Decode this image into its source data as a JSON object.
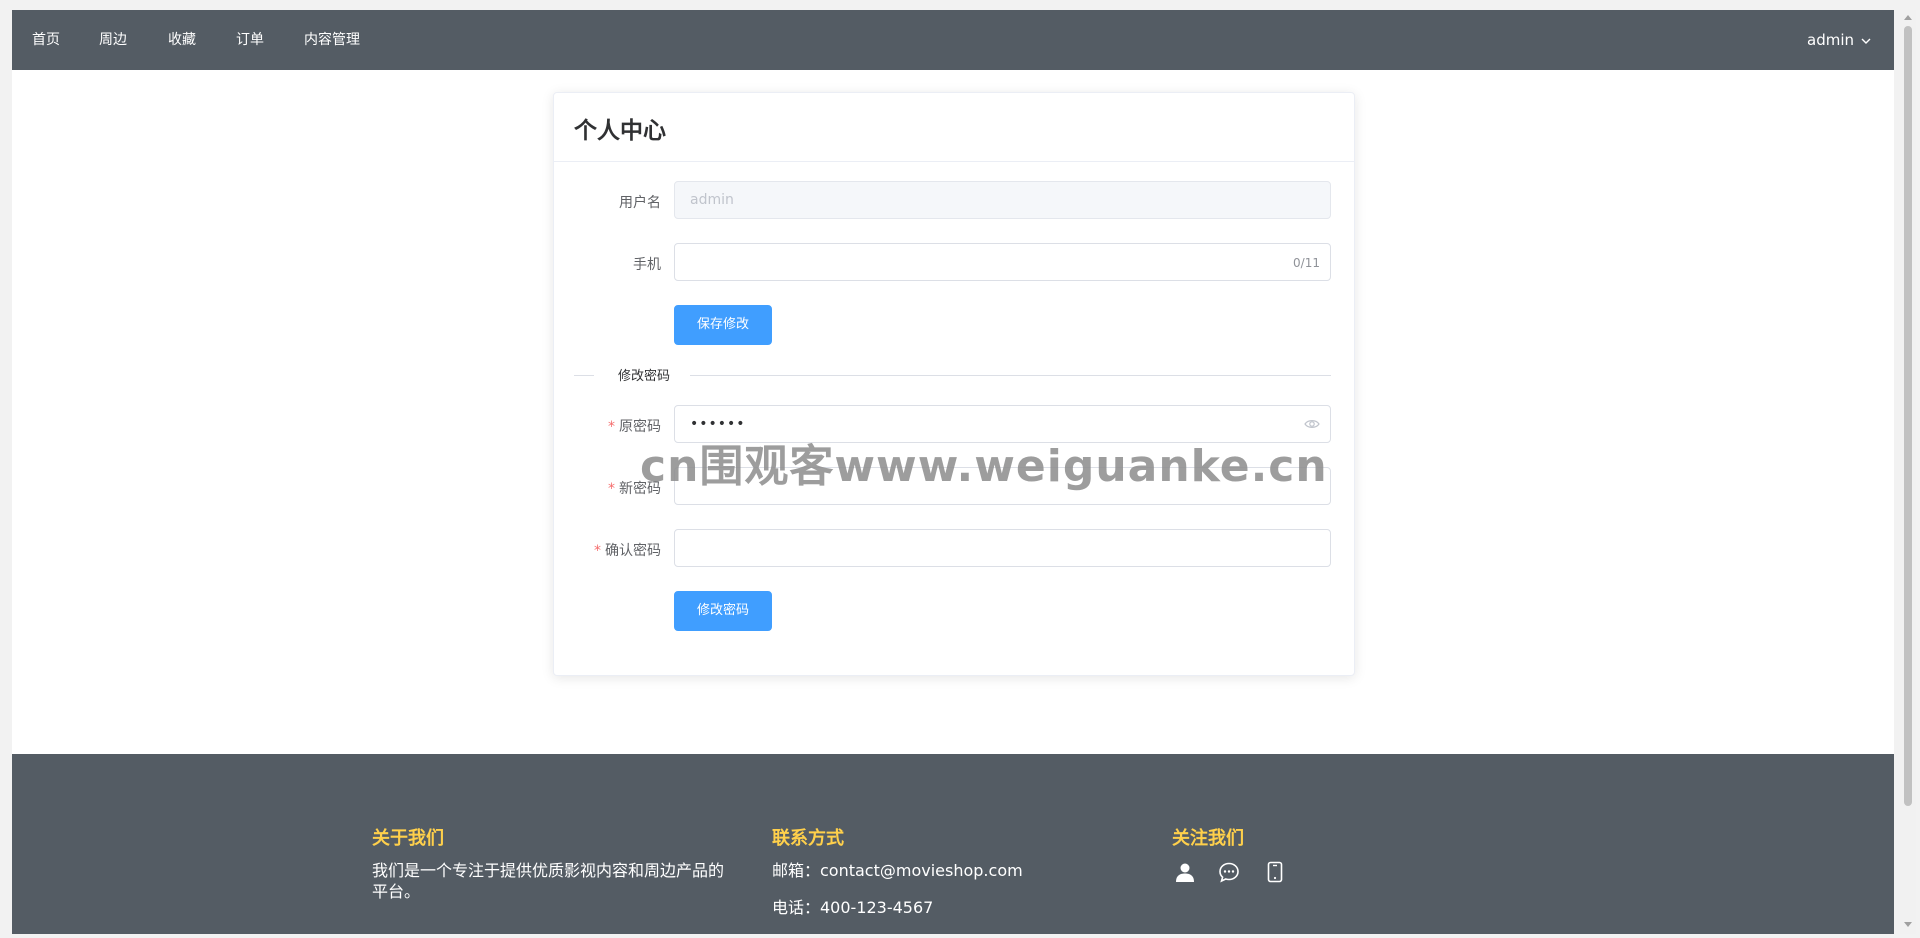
{
  "nav": {
    "items": [
      {
        "label": "首页"
      },
      {
        "label": "周边"
      },
      {
        "label": "收藏"
      },
      {
        "label": "订单"
      },
      {
        "label": "内容管理"
      }
    ],
    "user": "admin"
  },
  "card": {
    "title": "个人中心",
    "username_label": "用户名",
    "username_value": "admin",
    "phone_label": "手机",
    "phone_value": "",
    "phone_counter": "0/11",
    "save_button": "保存修改",
    "divider_text": "修改密码",
    "old_password_label": "原密码",
    "old_password_mask": "••••••",
    "new_password_label": "新密码",
    "confirm_password_label": "确认密码",
    "required_mark": "*",
    "change_password_button": "修改密码"
  },
  "watermark": "cn围观客www.weiguanke.cn",
  "footer": {
    "about_title": "关于我们",
    "about_text": "我们是一个专注于提供优质影视内容和周边产品的平台。",
    "contact_title": "联系方式",
    "email": "邮箱：contact@movieshop.com",
    "phone": "电话：400-123-4567",
    "follow_title": "关注我们",
    "social_icons": [
      "user-icon",
      "chat-icon",
      "mobile-icon"
    ]
  },
  "colors": {
    "nav_bg": "#545c64",
    "primary": "#409eff",
    "footer_heading": "#ffd04b",
    "required": "#f56c6c"
  }
}
